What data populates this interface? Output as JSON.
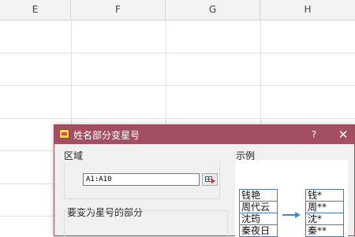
{
  "sheet": {
    "columns": [
      "E",
      "F",
      "G",
      "H"
    ]
  },
  "dialog": {
    "title": "姓名部分变星号",
    "help_label": "?",
    "close_label": "✕",
    "range_section_label": "区域",
    "range_value": "A1:A10",
    "part_section_label": "要变为星号的部分",
    "example_label": "示例",
    "before_names": [
      "钱艳",
      "周代云",
      "沈筠",
      "秦夜日"
    ],
    "after_names": [
      "钱*",
      "周**",
      "沈*",
      "秦**"
    ]
  },
  "colors": {
    "titlebar": "#a44e61",
    "example_border": "#4a7ab5",
    "arrow": "#4a86c6"
  },
  "icons": {
    "title": "app-icon",
    "range_picker": "cell-range-picker-icon",
    "example_arrow": "arrow-right-icon"
  }
}
